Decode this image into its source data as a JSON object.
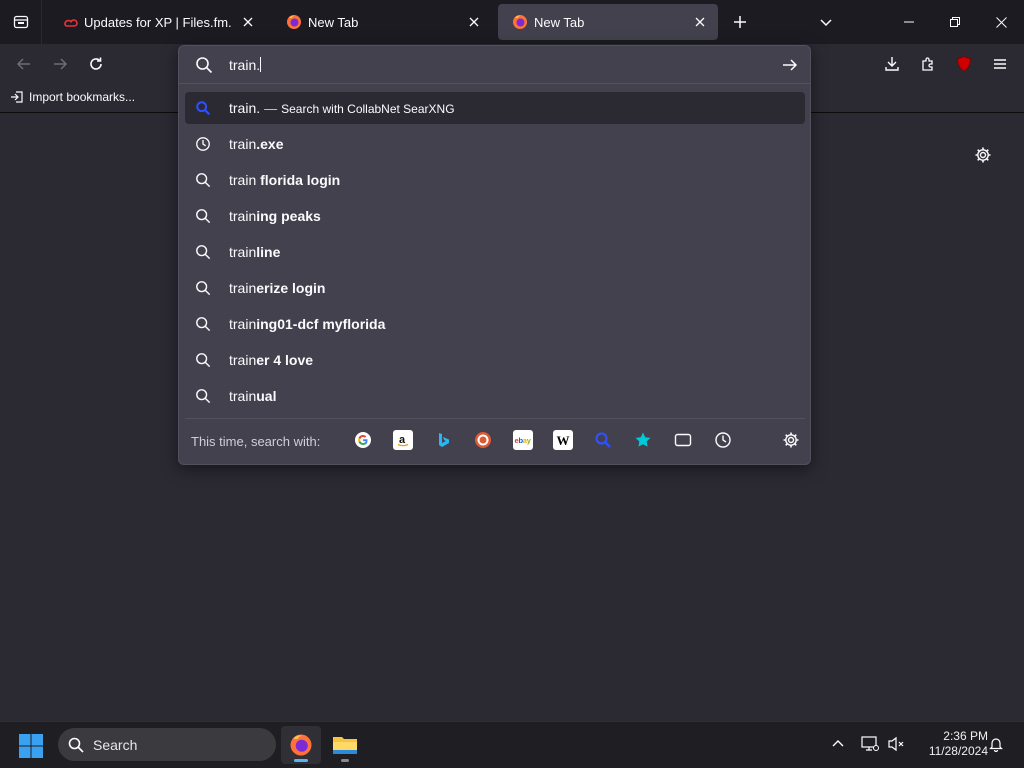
{
  "tabs": [
    {
      "title": "Updates for XP | Files.fm.",
      "favicon": "filesfm-icon"
    },
    {
      "title": "New Tab",
      "favicon": "firefox-icon"
    },
    {
      "title": "New Tab",
      "favicon": "firefox-icon",
      "active": true
    }
  ],
  "bookmarks": {
    "import_label": "Import bookmarks..."
  },
  "urlbar": {
    "value": "train."
  },
  "suggestions": [
    {
      "icon": "search-engine-icon",
      "prefix": "train.",
      "bold": "",
      "separator": "—",
      "action": "Search with CollabNet SearXNG",
      "selected": true
    },
    {
      "icon": "history-icon",
      "prefix": "train",
      "bold": ".exe"
    },
    {
      "icon": "search-icon",
      "prefix": "train ",
      "bold": "florida login"
    },
    {
      "icon": "search-icon",
      "prefix": "train",
      "bold": "ing peaks"
    },
    {
      "icon": "search-icon",
      "prefix": "train",
      "bold": "line"
    },
    {
      "icon": "search-icon",
      "prefix": "train",
      "bold": "erize login"
    },
    {
      "icon": "search-icon",
      "prefix": "train",
      "bold": "ing01-dcf myflorida"
    },
    {
      "icon": "search-icon",
      "prefix": "train",
      "bold": "er 4 love"
    },
    {
      "icon": "search-icon",
      "prefix": "train",
      "bold": "ual"
    }
  ],
  "oneoff": {
    "label": "This time, search with:",
    "engines": [
      "google-icon",
      "amazon-icon",
      "bing-icon",
      "duckduckgo-icon",
      "ebay-icon",
      "wikipedia-icon",
      "searxng-icon",
      "bookmarks-icon",
      "tabs-icon",
      "history-icon"
    ]
  },
  "taskbar": {
    "search_label": "Search",
    "time": "2:36 PM",
    "date": "11/28/2024"
  },
  "colors": {
    "accent": "#5bb4f0",
    "popup_bg": "#42414d",
    "toolbar_bg": "#2b2a33",
    "tabstrip_bg": "#1c1b22"
  }
}
